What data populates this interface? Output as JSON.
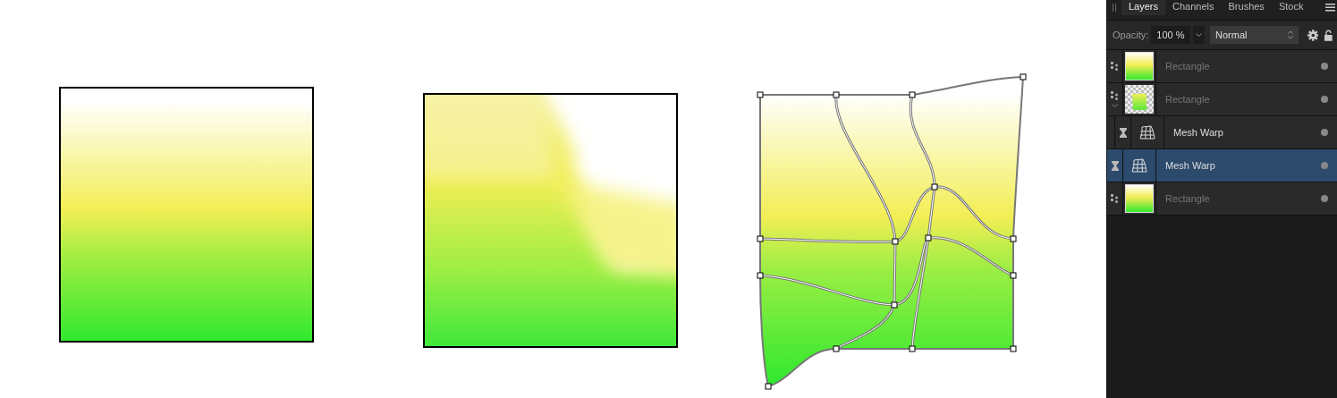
{
  "canvas": {
    "artworks": [
      {
        "kind": "gradient-square"
      },
      {
        "kind": "warped-square"
      },
      {
        "kind": "mesh-warp"
      }
    ]
  },
  "panel": {
    "tabs": [
      {
        "label": "Layers",
        "selected": true
      },
      {
        "label": "Channels",
        "selected": false
      },
      {
        "label": "Brushes",
        "selected": false
      },
      {
        "label": "Stock",
        "selected": false
      }
    ],
    "opacity_label": "Opacity:",
    "opacity_value": "100 %",
    "blend_mode": "Normal",
    "layers": [
      {
        "kind": "rectangle",
        "thumbnail": {
          "kind": "gradient"
        },
        "name": "Rectangle",
        "selected": false,
        "dimmed": true,
        "visible": true
      },
      {
        "kind": "rectangle",
        "thumbnail": {
          "kind": "warped"
        },
        "name": "Rectangle",
        "selected": false,
        "dimmed": true,
        "visible": true,
        "expanded": true,
        "children": [
          {
            "kind": "mesh-warp",
            "name": "Mesh Warp",
            "selected": false,
            "dimmed": false,
            "visible": true
          }
        ]
      },
      {
        "kind": "mesh-warp",
        "name": "Mesh Warp",
        "selected": true,
        "dimmed": false,
        "visible": true
      },
      {
        "kind": "rectangle",
        "thumbnail": {
          "kind": "gradient"
        },
        "name": "Rectangle",
        "selected": false,
        "dimmed": true,
        "visible": true
      }
    ]
  }
}
